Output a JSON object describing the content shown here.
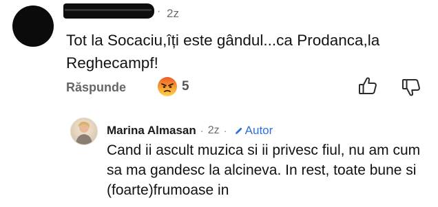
{
  "comment": {
    "time": "2z",
    "separator": "·",
    "text": "Tot la Socaciu,îți este gândul...ca Prodanca,la Reghecampf!",
    "actions": {
      "reply_label": "Răspunde",
      "reaction_icon": "angry-face-icon",
      "reaction_count": "5"
    }
  },
  "reply": {
    "author": "Marina Almasan",
    "separator": "·",
    "time": "2z",
    "badge_label": "Autor",
    "text": "Cand ii ascult muzica si ii privesc fiul,  nu am cum sa ma gandesc la alcineva. In rest, toate bune si (foarte)frumoase in",
    "accent_color": "#2d6fd6"
  }
}
